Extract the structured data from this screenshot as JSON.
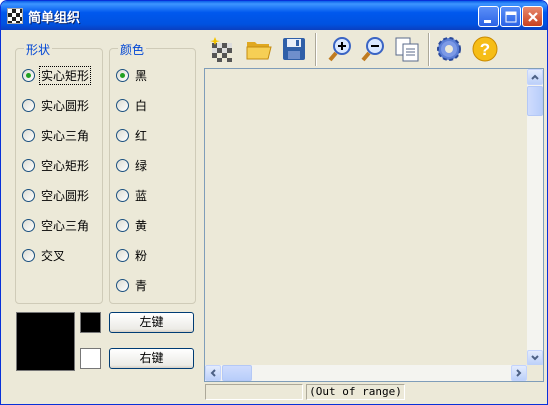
{
  "window": {
    "title": "简单组织"
  },
  "shape_group": {
    "title": "形状",
    "items": [
      {
        "label": "实心矩形",
        "selected": true
      },
      {
        "label": "实心圆形",
        "selected": false
      },
      {
        "label": "实心三角",
        "selected": false
      },
      {
        "label": "空心矩形",
        "selected": false
      },
      {
        "label": "空心圆形",
        "selected": false
      },
      {
        "label": "空心三角",
        "selected": false
      },
      {
        "label": "交叉",
        "selected": false
      }
    ]
  },
  "color_group": {
    "title": "颜色",
    "items": [
      {
        "label": "黑",
        "selected": true
      },
      {
        "label": "白",
        "selected": false
      },
      {
        "label": "红",
        "selected": false
      },
      {
        "label": "绿",
        "selected": false
      },
      {
        "label": "蓝",
        "selected": false
      },
      {
        "label": "黄",
        "selected": false
      },
      {
        "label": "粉",
        "selected": false
      },
      {
        "label": "青",
        "selected": false
      }
    ]
  },
  "color_preview": {
    "current": "#000000",
    "left": "#000000",
    "right": "#ffffff"
  },
  "buttons": {
    "left_key": "左键",
    "right_key": "右键"
  },
  "toolbar": {
    "icons": [
      "new-icon",
      "open-folder-icon",
      "save-icon",
      "zoom-in-icon",
      "zoom-out-icon",
      "copy-icon",
      "settings-icon",
      "help-icon"
    ]
  },
  "status": {
    "left": "",
    "coords": "(Out of range)"
  }
}
